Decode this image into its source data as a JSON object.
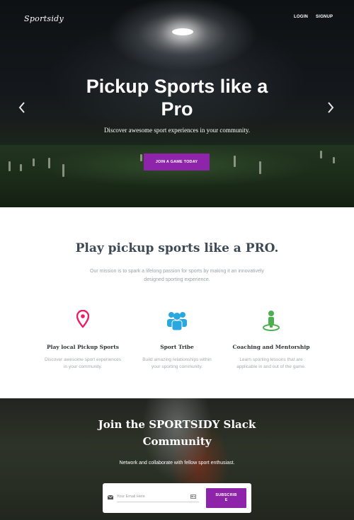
{
  "nav": {
    "logo": "Sportsidy",
    "login": "LOGIN",
    "signup": "SIGNUP"
  },
  "hero": {
    "title_line1": "Pickup Sports like a",
    "title_line2": "Pro",
    "subtitle": "Discover awesome sport experiences in your community.",
    "cta": "JOIN A GAME TODAY",
    "prev_icon": "chevron-left-icon",
    "next_icon": "chevron-right-icon"
  },
  "mission": {
    "title": "Play pickup sports like a PRO.",
    "text": "Our mission is to spark a lifelong passion for sports by making it an innovatively designed sporting experience."
  },
  "features": [
    {
      "icon": "map-pin-icon",
      "icon_color": "#e91e63",
      "title": "Play local Pickup Sports",
      "description": "Discover awesome sport experiences in your community."
    },
    {
      "icon": "group-icon",
      "icon_color": "#29a8e0",
      "title": "Sport Tribe",
      "description": "Build amazing relationships within your sporting community."
    },
    {
      "icon": "person-pin-icon",
      "icon_color": "#4caf50",
      "title": "Coaching and Mentorship",
      "description": "Learn sporting lessons that are applicable in and out of the game."
    }
  ],
  "slack": {
    "title_line1": "Join the SPORTSIDY Slack",
    "title_line2": "Community",
    "subtitle": "Network and collaborate with fellow sport enthusiast.",
    "email_placeholder": "Your Email Here",
    "subscribe_line1": "SUBSCRIB",
    "subscribe_line2": "E"
  },
  "colors": {
    "accent": "#8e24aa",
    "heading": "#3d4a55"
  }
}
